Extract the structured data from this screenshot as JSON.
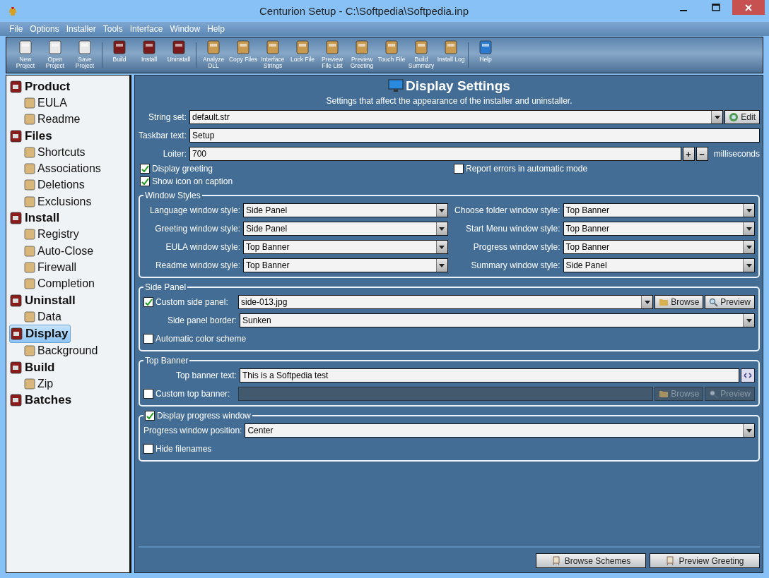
{
  "window": {
    "title": "Centurion Setup - C:\\Softpedia\\Softpedia.inp"
  },
  "menu": [
    "File",
    "Options",
    "Installer",
    "Tools",
    "Interface",
    "Window",
    "Help"
  ],
  "toolbar_groups": [
    {
      "buttons": [
        "New Project",
        "Open Project",
        "Save Project"
      ]
    },
    {
      "buttons": [
        "Build",
        "Install",
        "Uninstall"
      ]
    },
    {
      "buttons": [
        "Analyze DLL",
        "Copy Files",
        "Interface Strings",
        "Lock File",
        "Preview File List",
        "Preview Greeting",
        "Touch File",
        "Build Summary",
        "Install Log"
      ]
    },
    {
      "buttons": [
        "Help"
      ]
    }
  ],
  "sidebar": {
    "items": [
      {
        "label": "Product",
        "selected": false,
        "children": [
          {
            "label": "EULA",
            "selected": false
          },
          {
            "label": "Readme",
            "selected": false
          }
        ]
      },
      {
        "label": "Files",
        "selected": false,
        "children": [
          {
            "label": "Shortcuts",
            "selected": false
          },
          {
            "label": "Associations",
            "selected": false
          },
          {
            "label": "Deletions",
            "selected": false
          },
          {
            "label": "Exclusions",
            "selected": false
          }
        ]
      },
      {
        "label": "Install",
        "selected": false,
        "children": [
          {
            "label": "Registry",
            "selected": false
          },
          {
            "label": "Auto-Close",
            "selected": false
          },
          {
            "label": "Firewall",
            "selected": false
          },
          {
            "label": "Completion",
            "selected": false
          }
        ]
      },
      {
        "label": "Uninstall",
        "selected": false,
        "children": [
          {
            "label": "Data",
            "selected": false
          }
        ]
      },
      {
        "label": "Display",
        "selected": true,
        "children": [
          {
            "label": "Background",
            "selected": false
          }
        ]
      },
      {
        "label": "Build",
        "selected": false,
        "children": [
          {
            "label": "Zip",
            "selected": false
          }
        ]
      },
      {
        "label": "Batches",
        "selected": false
      }
    ]
  },
  "panel": {
    "title": "Display Settings",
    "subtitle": "Settings that affect the appearance of the installer and uninstaller.",
    "string_set": {
      "label": "String set:",
      "value": "default.str",
      "button": "Edit"
    },
    "taskbar_text": {
      "label": "Taskbar text:",
      "value": "Setup"
    },
    "loiter": {
      "label": "Loiter:",
      "value": "700",
      "buttons": [
        "+",
        "−"
      ],
      "unit": "milliseconds"
    },
    "options": [
      {
        "label": "Display greeting",
        "checked": true
      },
      {
        "label": "Report errors in automatic mode",
        "checked": false
      },
      {
        "label": "Show icon on caption",
        "checked": true
      }
    ],
    "window_styles": {
      "title": "Window Styles",
      "left": [
        {
          "label": "Language window style:",
          "value": "Side Panel"
        },
        {
          "label": "Greeting window style:",
          "value": "Side Panel"
        },
        {
          "label": "EULA window style:",
          "value": "Top Banner"
        },
        {
          "label": "Readme window style:",
          "value": "Top Banner"
        }
      ],
      "right": [
        {
          "label": "Choose folder window style:",
          "value": "Top Banner"
        },
        {
          "label": "Start Menu window style:",
          "value": "Top Banner"
        },
        {
          "label": "Progress window style:",
          "value": "Top Banner"
        },
        {
          "label": "Summary window style:",
          "value": "Side Panel"
        }
      ]
    },
    "side_panel": {
      "title": "Side Panel",
      "custom": {
        "label": "Custom side panel:",
        "checked": true,
        "value": "side-013.jpg"
      },
      "buttons": [
        {
          "label": "Browse",
          "disabled": false
        },
        {
          "label": "Preview",
          "disabled": false
        }
      ],
      "border": {
        "label": "Side panel border:",
        "value": "Sunken"
      },
      "auto_color": {
        "label": "Automatic color scheme",
        "checked": false
      }
    },
    "top_banner": {
      "title": "Top Banner",
      "text": {
        "label": "Top banner text:",
        "value": "This is a Softpedia test"
      },
      "custom": {
        "label": "Custom top banner:",
        "checked": false
      },
      "buttons": [
        {
          "label": "Browse",
          "disabled": true
        },
        {
          "label": "Preview",
          "disabled": true
        }
      ]
    },
    "progress": {
      "title": "Display progress window",
      "checked": true,
      "position": {
        "label": "Progress window position:",
        "value": "Center"
      },
      "hide_filenames": {
        "label": "Hide filenames",
        "checked": false
      }
    },
    "footer_buttons": [
      "Browse Schemes",
      "Preview Greeting"
    ]
  }
}
